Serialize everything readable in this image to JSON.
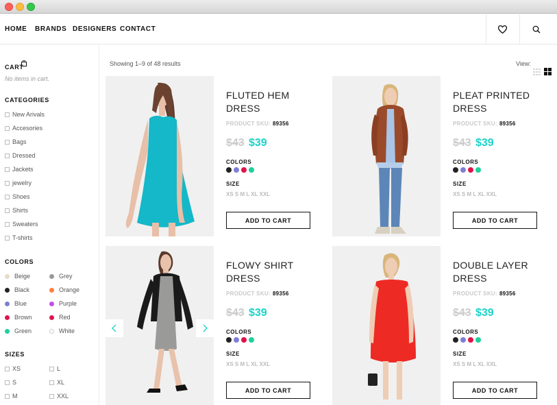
{
  "nav": {
    "links": [
      "HOME",
      "BRANDS",
      "DESIGNERS",
      "CONTACT"
    ],
    "wishlist_icon": "heart-icon",
    "search_icon": "search-icon"
  },
  "sidebar": {
    "cart_title": "CART",
    "cart_note": "No items in cart.",
    "categories_title": "CATEGORIES",
    "categories": [
      "New Arivals",
      "Accesories",
      "Bags",
      "Dressed",
      "Jackets",
      "jewelry",
      "Shoes",
      "Shirts",
      "Sweaters",
      "T-shirts"
    ],
    "colors_title": "COLORS",
    "colors": [
      {
        "name": "Beige",
        "hex": "#e6dccb"
      },
      {
        "name": "Grey",
        "hex": "#999999"
      },
      {
        "name": "Black",
        "hex": "#222222"
      },
      {
        "name": "Orange",
        "hex": "#ff7f3f"
      },
      {
        "name": "Blue",
        "hex": "#7d7fd6"
      },
      {
        "name": "Purple",
        "hex": "#c44ee6"
      },
      {
        "name": "Brown",
        "hex": "#e0134a"
      },
      {
        "name": "Red",
        "hex": "#e0134a"
      },
      {
        "name": "Green",
        "hex": "#1fd09a"
      },
      {
        "name": "White",
        "hex": "#ffffff"
      }
    ],
    "sizes_title": "SIZES",
    "sizes": [
      "XS",
      "L",
      "S",
      "XL",
      "M",
      "XXL"
    ]
  },
  "results": {
    "showing": "Showing 1–9 of 48 results",
    "view_label": "View:"
  },
  "products": [
    {
      "title": "FLUTED HEM DRESS",
      "sku_label": "PRODUCT SKU:",
      "sku": "89356",
      "old_price": "$43",
      "new_price": "$39",
      "colors_label": "COLORS",
      "size_label": "SIZE",
      "sizes": "XS S M L XL XXL",
      "button": "ADD TO CART",
      "swatches": [
        "#222222",
        "#7d7fd6",
        "#e0134a",
        "#1fd09a"
      ]
    },
    {
      "title": "PLEAT PRINTED DRESS",
      "sku_label": "PRODUCT SKU:",
      "sku": "89356",
      "old_price": "$43",
      "new_price": "$39",
      "colors_label": "COLORS",
      "size_label": "SIZE",
      "sizes": "XS S M L XL XXL",
      "button": "ADD TO CART",
      "swatches": [
        "#222222",
        "#7d7fd6",
        "#e0134a",
        "#1fd09a"
      ]
    },
    {
      "title": "FLOWY SHIRT DRESS",
      "sku_label": "PRODUCT SKU:",
      "sku": "89356",
      "old_price": "$43",
      "new_price": "$39",
      "colors_label": "COLORS",
      "size_label": "SIZE",
      "sizes": "XS S M L XL XXL",
      "button": "ADD TO CART",
      "swatches": [
        "#222222",
        "#7d7fd6",
        "#e0134a",
        "#1fd09a"
      ]
    },
    {
      "title": "DOUBLE LAYER DRESS",
      "sku_label": "PRODUCT SKU:",
      "sku": "89356",
      "old_price": "$43",
      "new_price": "$39",
      "colors_label": "COLORS",
      "size_label": "SIZE",
      "sizes": "XS S M L XL XXL",
      "button": "ADD TO CART",
      "swatches": [
        "#222222",
        "#7d7fd6",
        "#e0134a",
        "#1fd09a"
      ]
    }
  ]
}
